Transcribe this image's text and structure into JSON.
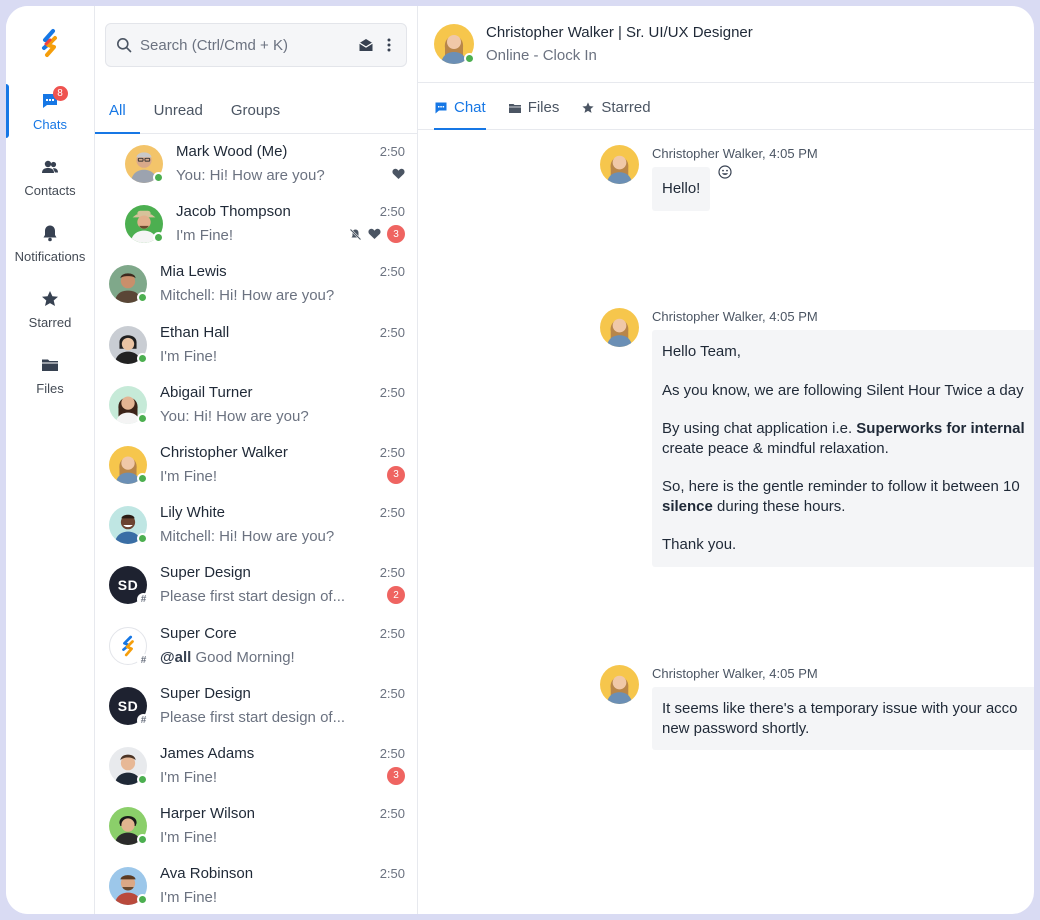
{
  "nav": {
    "badge": "8",
    "items": [
      {
        "label": "Chats",
        "icon": "chat-bubble-icon"
      },
      {
        "label": "Contacts",
        "icon": "contacts-icon"
      },
      {
        "label": "Notifications",
        "icon": "bell-icon"
      },
      {
        "label": "Starred",
        "icon": "star-icon"
      },
      {
        "label": "Files",
        "icon": "folder-icon"
      }
    ]
  },
  "search": {
    "placeholder": "Search (Ctrl/Cmd + K)"
  },
  "list_tabs": [
    "All",
    "Unread",
    "Groups"
  ],
  "chats": [
    {
      "name": "Mark Wood (Me)",
      "preview": "You: Hi! How are you?",
      "time": "2:50"
    },
    {
      "name": "Jacob Thompson",
      "preview": "I'm Fine!",
      "time": "2:50",
      "count": "3"
    },
    {
      "name": "Mia Lewis",
      "preview": "Mitchell: Hi! How are you?",
      "time": "2:50"
    },
    {
      "name": "Ethan Hall",
      "preview": "I'm Fine!",
      "time": "2:50"
    },
    {
      "name": "Abigail Turner",
      "preview": "You: Hi! How are you?",
      "time": "2:50"
    },
    {
      "name": "Christopher Walker",
      "preview": "I'm Fine!",
      "time": "2:50",
      "count": "3"
    },
    {
      "name": "Lily White",
      "preview": "Mitchell: Hi! How are you?",
      "time": "2:50"
    },
    {
      "name": "Super Design",
      "initials": "SD",
      "preview": "Please first start design of...",
      "time": "2:50",
      "count": "2"
    },
    {
      "name": "Super Core",
      "preview_mention": "@all",
      "preview": "Good Morning!",
      "time": "2:50"
    },
    {
      "name": "Super Design",
      "initials": "SD",
      "preview": "Please first start design of...",
      "time": "2:50"
    },
    {
      "name": "James Adams",
      "preview": "I'm Fine!",
      "time": "2:50",
      "count": "3"
    },
    {
      "name": "Harper Wilson",
      "preview": "I'm Fine!",
      "time": "2:50"
    },
    {
      "name": "Ava Robinson",
      "preview": "I'm Fine!",
      "time": "2:50"
    }
  ],
  "conversation": {
    "title": "Christopher Walker | Sr. UI/UX Designer",
    "status": "Online - Clock In",
    "tabs": [
      "Chat",
      "Files",
      "Starred"
    ],
    "messages": [
      {
        "sender": "Christopher Walker, 4:05 PM",
        "text": "Hello!"
      },
      {
        "sender": "Christopher Walker, 4:05 PM",
        "p1": "Hello Team,",
        "p2": "As you know, we are following Silent Hour Twice a day",
        "p3a": "By using chat application i.e. ",
        "p3b": "Superworks for internal",
        "p3c": "create peace & mindful relaxation.",
        "p4a": "So, here is the gentle reminder to follow it between 10",
        "p4b": "silence",
        "p4c": " during these hours.",
        "p5": "Thank you."
      },
      {
        "sender": "Christopher Walker, 4:05 PM",
        "l1": "It seems like there's a temporary issue with your acco",
        "l2": "new password shortly."
      }
    ]
  },
  "colors": {
    "accent": "#1677e5",
    "badge": "#ef6461",
    "online": "#4caf50"
  }
}
